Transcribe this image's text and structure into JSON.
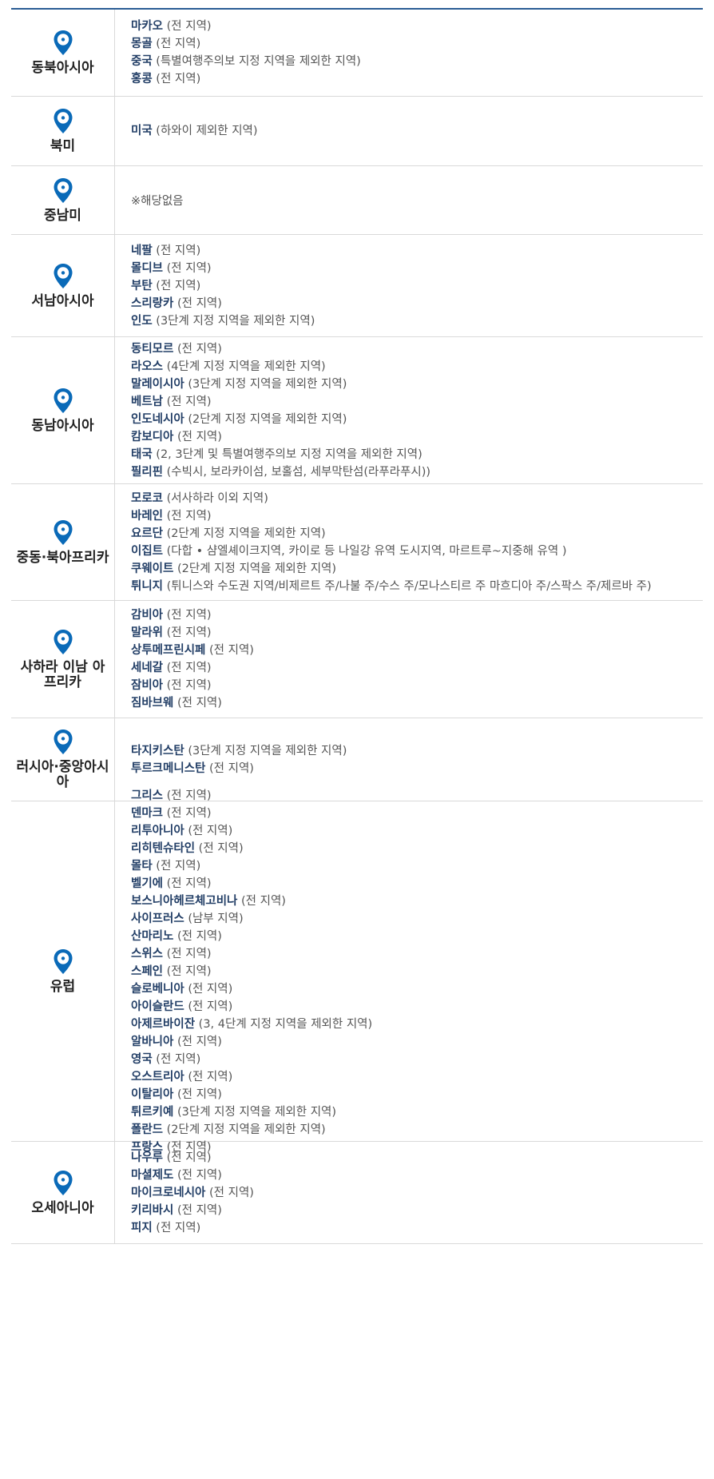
{
  "regions": [
    {
      "name": "동북아시아",
      "countries": [
        {
          "name": "마카오",
          "note": "(전 지역)"
        },
        {
          "name": "몽골",
          "note": "(전 지역)"
        },
        {
          "name": "중국",
          "note": "(특별여행주의보 지정 지역을 제외한 지역)"
        },
        {
          "name": "홍콩",
          "note": "(전 지역)"
        }
      ]
    },
    {
      "name": "북미",
      "countries": [
        {
          "name": "미국",
          "note": "(하와이 제외한 지역)"
        }
      ]
    },
    {
      "name": "중남미",
      "note": "※해당없음",
      "countries": []
    },
    {
      "name": "서남아시아",
      "countries": [
        {
          "name": "네팔",
          "note": "(전 지역)"
        },
        {
          "name": "몰디브",
          "note": "(전 지역)"
        },
        {
          "name": "부탄",
          "note": "(전 지역)"
        },
        {
          "name": "스리랑카",
          "note": "(전 지역)"
        },
        {
          "name": "인도",
          "note": "(3단계 지정 지역을 제외한 지역)"
        }
      ]
    },
    {
      "name": "동남아시아",
      "countries": [
        {
          "name": "동티모르",
          "note": "(전 지역)"
        },
        {
          "name": "라오스",
          "note": "(4단계 지정 지역을 제외한 지역)"
        },
        {
          "name": "말레이시아",
          "note": "(3단계 지정 지역을 제외한 지역)"
        },
        {
          "name": "베트남",
          "note": "(전 지역)"
        },
        {
          "name": "인도네시아",
          "note": "(2단계 지정 지역을 제외한 지역)"
        },
        {
          "name": "캄보디아",
          "note": "(전 지역)"
        },
        {
          "name": "태국",
          "note": "(2, 3단계 및 특별여행주의보 지정 지역을 제외한 지역)"
        },
        {
          "name": "필리핀",
          "note": "(수빅시, 보라카이섬, 보홀섬, 세부막탄섬(라푸라푸시))"
        }
      ]
    },
    {
      "name": "중동·북아프리카",
      "countries": [
        {
          "name": "모로코",
          "note": "(서사하라 이외 지역)"
        },
        {
          "name": "바레인",
          "note": "(전 지역)"
        },
        {
          "name": "요르단",
          "note": "(2단계 지정 지역을 제외한 지역)"
        },
        {
          "name": "이집트",
          "note": "(다합 • 샴엘셰이크지역, 카이로 등 나일강 유역 도시지역, 마르트루~지중해 유역 )"
        },
        {
          "name": "쿠웨이트",
          "note": "(2단계 지정 지역을 제외한 지역)"
        },
        {
          "name": "튀니지",
          "note": "(튀니스와 수도권 지역/비제르트 주/나불 주/수스 주/모나스티르 주 마흐디아 주/스팍스 주/제르바 주)"
        }
      ]
    },
    {
      "name": "사하라 이남 아프리카",
      "countries": [
        {
          "name": "감비아",
          "note": "(전 지역)"
        },
        {
          "name": "말라위",
          "note": "(전 지역)"
        },
        {
          "name": "상투메프린시페",
          "note": "(전 지역)"
        },
        {
          "name": "세네갈",
          "note": "(전 지역)"
        },
        {
          "name": "잠비아",
          "note": "(전 지역)"
        },
        {
          "name": "짐바브웨",
          "note": "(전 지역)"
        }
      ]
    },
    {
      "name": "러시아·중앙아시아",
      "countries": [
        {
          "name": "타지키스탄",
          "note": "(3단계 지정 지역을 제외한 지역)"
        },
        {
          "name": "투르크메니스탄",
          "note": "(전 지역)"
        }
      ]
    },
    {
      "name": "유럽",
      "countries": [
        {
          "name": "그리스",
          "note": "(전 지역)"
        },
        {
          "name": "덴마크",
          "note": "(전 지역)"
        },
        {
          "name": "리투아니아",
          "note": "(전 지역)"
        },
        {
          "name": "리히텐슈타인",
          "note": "(전 지역)"
        },
        {
          "name": "몰타",
          "note": "(전 지역)"
        },
        {
          "name": "벨기에",
          "note": "(전 지역)"
        },
        {
          "name": "보스니아헤르체고비나",
          "note": "(전 지역)"
        },
        {
          "name": "사이프러스",
          "note": "(남부 지역)"
        },
        {
          "name": "산마리노",
          "note": "(전 지역)"
        },
        {
          "name": "스위스",
          "note": "(전 지역)"
        },
        {
          "name": "스페인",
          "note": "(전 지역)"
        },
        {
          "name": "슬로베니아",
          "note": "(전 지역)"
        },
        {
          "name": "아이슬란드",
          "note": "(전 지역)"
        },
        {
          "name": "아제르바이잔",
          "note": "(3, 4단계 지정 지역을 제외한 지역)"
        },
        {
          "name": "알바니아",
          "note": "(전 지역)"
        },
        {
          "name": "영국",
          "note": "(전 지역)"
        },
        {
          "name": "오스트리아",
          "note": "(전 지역)"
        },
        {
          "name": "이탈리아",
          "note": "(전 지역)"
        },
        {
          "name": "튀르키예",
          "note": "(3단계 지정 지역을 제외한 지역)"
        },
        {
          "name": "폴란드",
          "note": "(2단계 지정 지역을 제외한 지역)"
        },
        {
          "name": "프랑스",
          "note": "(전 지역)"
        }
      ]
    },
    {
      "name": "오세아니아",
      "countries": [
        {
          "name": "나우루",
          "note": "(전 지역)"
        },
        {
          "name": "마셜제도",
          "note": "(전 지역)"
        },
        {
          "name": "마이크로네시아",
          "note": "(전 지역)"
        },
        {
          "name": "키리바시",
          "note": "(전 지역)"
        },
        {
          "name": "피지",
          "note": "(전 지역)"
        }
      ]
    }
  ],
  "colors": {
    "pin": "#0a6ab8",
    "country_name": "#223e66",
    "header_border": "#2a5d95"
  },
  "icons": {
    "region": "map-pin-icon"
  }
}
